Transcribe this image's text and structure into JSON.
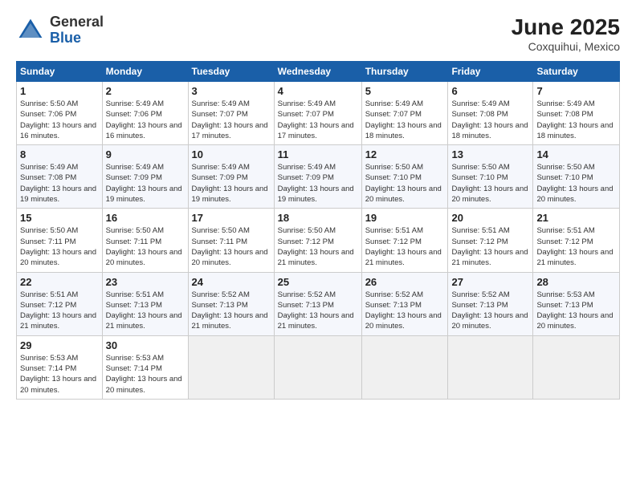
{
  "header": {
    "logo_general": "General",
    "logo_blue": "Blue",
    "month_year": "June 2025",
    "location": "Coxquihui, Mexico"
  },
  "weekdays": [
    "Sunday",
    "Monday",
    "Tuesday",
    "Wednesday",
    "Thursday",
    "Friday",
    "Saturday"
  ],
  "weeks": [
    [
      {
        "day": "1",
        "sunrise": "Sunrise: 5:50 AM",
        "sunset": "Sunset: 7:06 PM",
        "daylight": "Daylight: 13 hours and 16 minutes."
      },
      {
        "day": "2",
        "sunrise": "Sunrise: 5:49 AM",
        "sunset": "Sunset: 7:06 PM",
        "daylight": "Daylight: 13 hours and 16 minutes."
      },
      {
        "day": "3",
        "sunrise": "Sunrise: 5:49 AM",
        "sunset": "Sunset: 7:07 PM",
        "daylight": "Daylight: 13 hours and 17 minutes."
      },
      {
        "day": "4",
        "sunrise": "Sunrise: 5:49 AM",
        "sunset": "Sunset: 7:07 PM",
        "daylight": "Daylight: 13 hours and 17 minutes."
      },
      {
        "day": "5",
        "sunrise": "Sunrise: 5:49 AM",
        "sunset": "Sunset: 7:07 PM",
        "daylight": "Daylight: 13 hours and 18 minutes."
      },
      {
        "day": "6",
        "sunrise": "Sunrise: 5:49 AM",
        "sunset": "Sunset: 7:08 PM",
        "daylight": "Daylight: 13 hours and 18 minutes."
      },
      {
        "day": "7",
        "sunrise": "Sunrise: 5:49 AM",
        "sunset": "Sunset: 7:08 PM",
        "daylight": "Daylight: 13 hours and 18 minutes."
      }
    ],
    [
      {
        "day": "8",
        "sunrise": "Sunrise: 5:49 AM",
        "sunset": "Sunset: 7:08 PM",
        "daylight": "Daylight: 13 hours and 19 minutes."
      },
      {
        "day": "9",
        "sunrise": "Sunrise: 5:49 AM",
        "sunset": "Sunset: 7:09 PM",
        "daylight": "Daylight: 13 hours and 19 minutes."
      },
      {
        "day": "10",
        "sunrise": "Sunrise: 5:49 AM",
        "sunset": "Sunset: 7:09 PM",
        "daylight": "Daylight: 13 hours and 19 minutes."
      },
      {
        "day": "11",
        "sunrise": "Sunrise: 5:49 AM",
        "sunset": "Sunset: 7:09 PM",
        "daylight": "Daylight: 13 hours and 19 minutes."
      },
      {
        "day": "12",
        "sunrise": "Sunrise: 5:50 AM",
        "sunset": "Sunset: 7:10 PM",
        "daylight": "Daylight: 13 hours and 20 minutes."
      },
      {
        "day": "13",
        "sunrise": "Sunrise: 5:50 AM",
        "sunset": "Sunset: 7:10 PM",
        "daylight": "Daylight: 13 hours and 20 minutes."
      },
      {
        "day": "14",
        "sunrise": "Sunrise: 5:50 AM",
        "sunset": "Sunset: 7:10 PM",
        "daylight": "Daylight: 13 hours and 20 minutes."
      }
    ],
    [
      {
        "day": "15",
        "sunrise": "Sunrise: 5:50 AM",
        "sunset": "Sunset: 7:11 PM",
        "daylight": "Daylight: 13 hours and 20 minutes."
      },
      {
        "day": "16",
        "sunrise": "Sunrise: 5:50 AM",
        "sunset": "Sunset: 7:11 PM",
        "daylight": "Daylight: 13 hours and 20 minutes."
      },
      {
        "day": "17",
        "sunrise": "Sunrise: 5:50 AM",
        "sunset": "Sunset: 7:11 PM",
        "daylight": "Daylight: 13 hours and 20 minutes."
      },
      {
        "day": "18",
        "sunrise": "Sunrise: 5:50 AM",
        "sunset": "Sunset: 7:12 PM",
        "daylight": "Daylight: 13 hours and 21 minutes."
      },
      {
        "day": "19",
        "sunrise": "Sunrise: 5:51 AM",
        "sunset": "Sunset: 7:12 PM",
        "daylight": "Daylight: 13 hours and 21 minutes."
      },
      {
        "day": "20",
        "sunrise": "Sunrise: 5:51 AM",
        "sunset": "Sunset: 7:12 PM",
        "daylight": "Daylight: 13 hours and 21 minutes."
      },
      {
        "day": "21",
        "sunrise": "Sunrise: 5:51 AM",
        "sunset": "Sunset: 7:12 PM",
        "daylight": "Daylight: 13 hours and 21 minutes."
      }
    ],
    [
      {
        "day": "22",
        "sunrise": "Sunrise: 5:51 AM",
        "sunset": "Sunset: 7:12 PM",
        "daylight": "Daylight: 13 hours and 21 minutes."
      },
      {
        "day": "23",
        "sunrise": "Sunrise: 5:51 AM",
        "sunset": "Sunset: 7:13 PM",
        "daylight": "Daylight: 13 hours and 21 minutes."
      },
      {
        "day": "24",
        "sunrise": "Sunrise: 5:52 AM",
        "sunset": "Sunset: 7:13 PM",
        "daylight": "Daylight: 13 hours and 21 minutes."
      },
      {
        "day": "25",
        "sunrise": "Sunrise: 5:52 AM",
        "sunset": "Sunset: 7:13 PM",
        "daylight": "Daylight: 13 hours and 21 minutes."
      },
      {
        "day": "26",
        "sunrise": "Sunrise: 5:52 AM",
        "sunset": "Sunset: 7:13 PM",
        "daylight": "Daylight: 13 hours and 20 minutes."
      },
      {
        "day": "27",
        "sunrise": "Sunrise: 5:52 AM",
        "sunset": "Sunset: 7:13 PM",
        "daylight": "Daylight: 13 hours and 20 minutes."
      },
      {
        "day": "28",
        "sunrise": "Sunrise: 5:53 AM",
        "sunset": "Sunset: 7:13 PM",
        "daylight": "Daylight: 13 hours and 20 minutes."
      }
    ],
    [
      {
        "day": "29",
        "sunrise": "Sunrise: 5:53 AM",
        "sunset": "Sunset: 7:14 PM",
        "daylight": "Daylight: 13 hours and 20 minutes."
      },
      {
        "day": "30",
        "sunrise": "Sunrise: 5:53 AM",
        "sunset": "Sunset: 7:14 PM",
        "daylight": "Daylight: 13 hours and 20 minutes."
      },
      null,
      null,
      null,
      null,
      null
    ]
  ]
}
